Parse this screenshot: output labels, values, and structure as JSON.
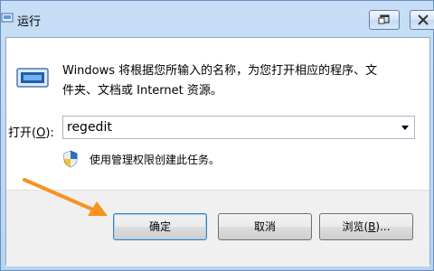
{
  "window": {
    "title": "运行",
    "restore_icon": "restore-icon",
    "close_icon": "close-icon"
  },
  "description": {
    "line1": "Windows 将根据您所输入的名称，为您打开相应的程序、文",
    "line2": "件夹、文档或 Internet 资源。"
  },
  "open": {
    "label_prefix": "打开(",
    "label_hotkey": "O",
    "label_suffix": "):",
    "value": "regedit"
  },
  "admin_note": "使用管理权限创建此任务。",
  "buttons": {
    "ok": "确定",
    "cancel": "取消",
    "browse_prefix": "浏览(",
    "browse_hotkey": "B",
    "browse_suffix": ")..."
  },
  "colors": {
    "annotation_arrow": "#f7931e",
    "title_gradient_top": "#c7def6",
    "button_bar": "#f0f0f0"
  }
}
